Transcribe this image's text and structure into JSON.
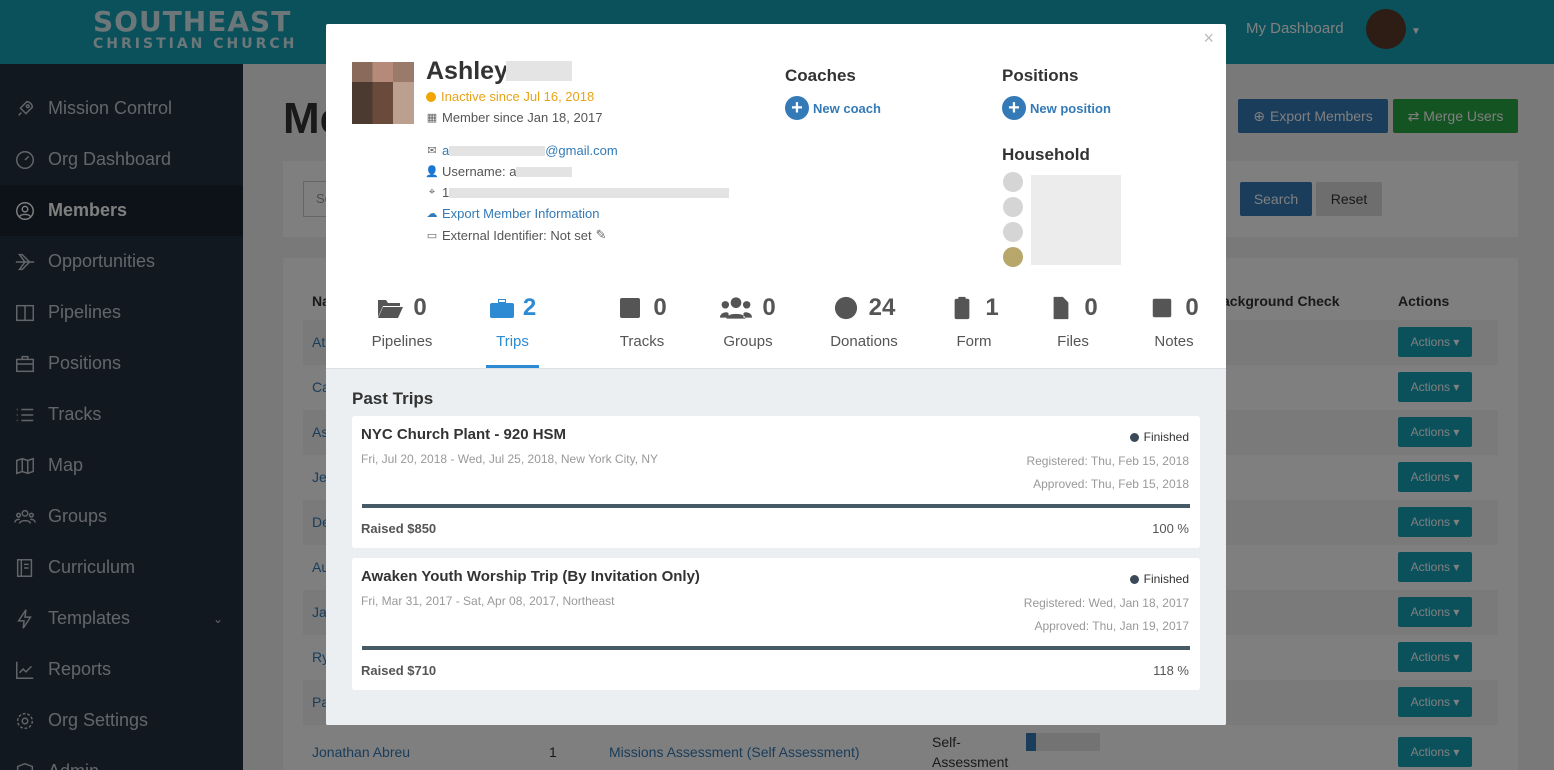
{
  "brand": {
    "line1": "SOUTHEAST",
    "line2": "CHRISTIAN CHURCH"
  },
  "topnav": {
    "dashboard_link": "My Dashboard"
  },
  "sidebar": {
    "items": [
      {
        "label": "Mission Control",
        "icon": "rocket-icon"
      },
      {
        "label": "Org Dashboard",
        "icon": "dashboard-icon"
      },
      {
        "label": "Members",
        "icon": "user-icon",
        "active": true
      },
      {
        "label": "Opportunities",
        "icon": "plane-icon"
      },
      {
        "label": "Pipelines",
        "icon": "columns-icon"
      },
      {
        "label": "Positions",
        "icon": "briefcase-icon"
      },
      {
        "label": "Tracks",
        "icon": "list-icon"
      },
      {
        "label": "Map",
        "icon": "map-icon"
      },
      {
        "label": "Groups",
        "icon": "users-icon"
      },
      {
        "label": "Curriculum",
        "icon": "book-icon"
      },
      {
        "label": "Templates",
        "icon": "bolt-icon"
      },
      {
        "label": "Reports",
        "icon": "chart-icon"
      },
      {
        "label": "Org Settings",
        "icon": "gear-icon"
      },
      {
        "label": "Admin",
        "icon": "shield-icon"
      }
    ]
  },
  "background_page": {
    "title": "Me",
    "export_button": "Export Members",
    "merge_button": "Merge Users",
    "search_placeholder": "Se",
    "search_button": "Search",
    "reset_button": "Reset",
    "col_name": "Na",
    "col_background": "ackground Check",
    "col_actions": "Actions",
    "action_label": "Actions",
    "rows": [
      "At",
      "Ca",
      "As",
      "Je",
      "De",
      "Au",
      "Ja",
      "Ry",
      "Pa"
    ],
    "last_row": {
      "name": "Jonathan Abreu",
      "count": "1",
      "assessment": "Missions Assessment (Self Assessment)",
      "type_line1": "Self-",
      "type_line2": "Assessment"
    }
  },
  "member": {
    "first_name": "Ashley",
    "status": "Inactive since Jul 16, 2018",
    "member_since": "Member since Jan 18, 2017",
    "email_domain": "@gmail.com",
    "email_prefix": "a",
    "username_label": "Username: a",
    "address_prefix": "1",
    "export_link": "Export Member Information",
    "external_id": "External Identifier: Not set"
  },
  "coaches": {
    "title": "Coaches",
    "add_label": "New coach"
  },
  "positions": {
    "title": "Positions",
    "add_label": "New position"
  },
  "household": {
    "title": "Household"
  },
  "stats": [
    {
      "label": "Pipelines",
      "count": "0",
      "icon": "folder-open-icon"
    },
    {
      "label": "Trips",
      "count": "2",
      "icon": "briefcase-icon",
      "active": true
    },
    {
      "label": "Tracks",
      "count": "0",
      "icon": "check-square-icon"
    },
    {
      "label": "Groups",
      "count": "0",
      "icon": "users-icon"
    },
    {
      "label": "Donations",
      "count": "24",
      "icon": "heart-icon"
    },
    {
      "label": "Form",
      "count": "1",
      "icon": "clipboard-icon"
    },
    {
      "label": "Files",
      "count": "0",
      "icon": "file-icon"
    },
    {
      "label": "Notes",
      "count": "0",
      "icon": "edit-icon"
    }
  ],
  "past_trips": {
    "title": "Past Trips",
    "trips": [
      {
        "name": "NYC Church Plant - 920 HSM",
        "dates": "Fri, Jul 20, 2018 - Wed, Jul 25, 2018, New York City, NY",
        "status": "Finished",
        "registered": "Registered: Thu, Feb 15, 2018",
        "approved": "Approved: Thu, Feb 15, 2018",
        "raised": "Raised $850",
        "percent_label": "100 %",
        "progress": 1.0
      },
      {
        "name": "Awaken Youth Worship Trip (By Invitation Only)",
        "dates": "Fri, Mar 31, 2017 - Sat, Apr 08, 2017, Northeast",
        "status": "Finished",
        "registered": "Registered: Wed, Jan 18, 2017",
        "approved": "Approved: Thu, Jan 19, 2017",
        "raised": "Raised $710",
        "percent_label": "118 %",
        "progress": 1.0
      }
    ]
  },
  "colors": {
    "topbar": "#17a2b8",
    "sidebar": "#24303f",
    "accent": "#2d8bd4",
    "warning": "#f0a500",
    "success": "#28a745"
  }
}
